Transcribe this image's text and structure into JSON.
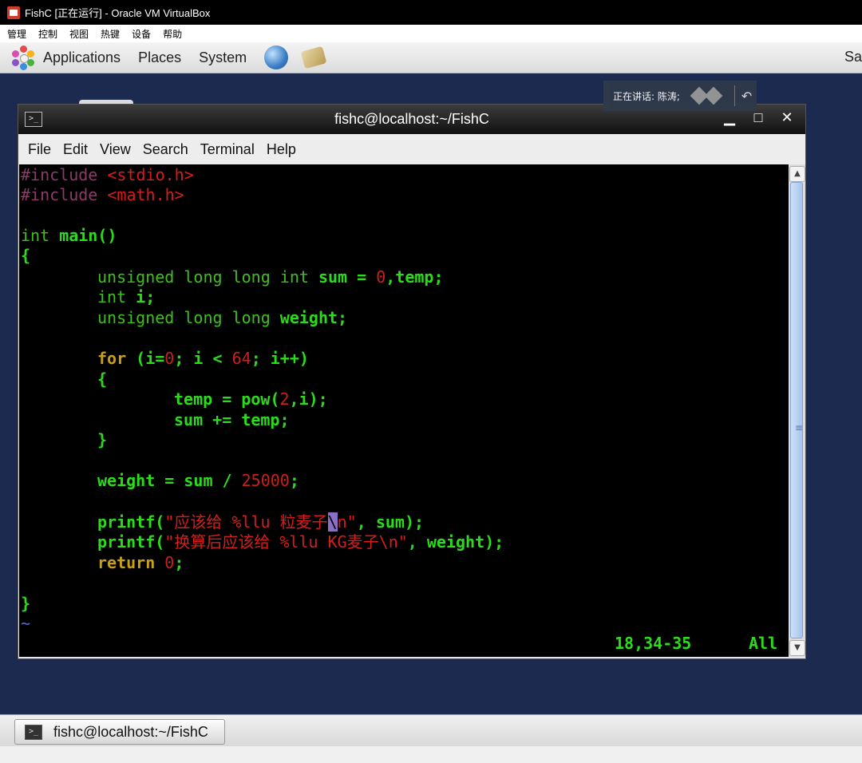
{
  "host": {
    "title": "FishC [正在运行] - Oracle VM VirtualBox",
    "menu": [
      "管理",
      "控制",
      "视图",
      "热键",
      "设备",
      "帮助"
    ]
  },
  "gnome_panel": {
    "items": [
      "Applications",
      "Places",
      "System"
    ],
    "right_text": "Sa"
  },
  "notification": {
    "text": "正在讲话: 陈涛;"
  },
  "terminal": {
    "title": "fishc@localhost:~/FishC",
    "menu": [
      "File",
      "Edit",
      "View",
      "Search",
      "Terminal",
      "Help"
    ],
    "status_position": "18,34-35",
    "status_scroll": "All"
  },
  "code": {
    "inc1_dir": "#include ",
    "inc1_file": "<stdio.h>",
    "inc2_dir": "#include ",
    "inc2_file": "<math.h>",
    "main_type": "int ",
    "main_name": "main()",
    "open_brace": "{",
    "l6_type": "unsigned long long int ",
    "l6_a": "sum = ",
    "l6_num": "0",
    "l6_b": ",temp;",
    "l7_type": "int ",
    "l7_a": "i;",
    "l8_type": "unsigned long long ",
    "l8_a": "weight;",
    "l10_kw": "for ",
    "l10_a": "(i=",
    "l10_n1": "0",
    "l10_b": "; i < ",
    "l10_n2": "64",
    "l10_c": "; i++)",
    "l11": "{",
    "l12_a": "temp = pow(",
    "l12_n": "2",
    "l12_b": ",i);",
    "l13": "sum += temp;",
    "l14": "}",
    "l16_a": "weight = sum / ",
    "l16_n": "25000",
    "l16_b": ";",
    "l18_a": "printf(",
    "l18_str1": "\"应该给 %llu 粒麦子",
    "l18_cur": "\\",
    "l18_str2": "n\"",
    "l18_b": ", sum);",
    "l19_a": "printf(",
    "l19_str": "\"换算后应该给 %llu KG麦子\\n\"",
    "l19_b": ", weight);",
    "l20_kw": "return ",
    "l20_n": "0",
    "l20_b": ";",
    "close_brace": "}",
    "tilde": "~"
  },
  "taskbar": {
    "task_label": "fishc@localhost:~/FishC"
  }
}
